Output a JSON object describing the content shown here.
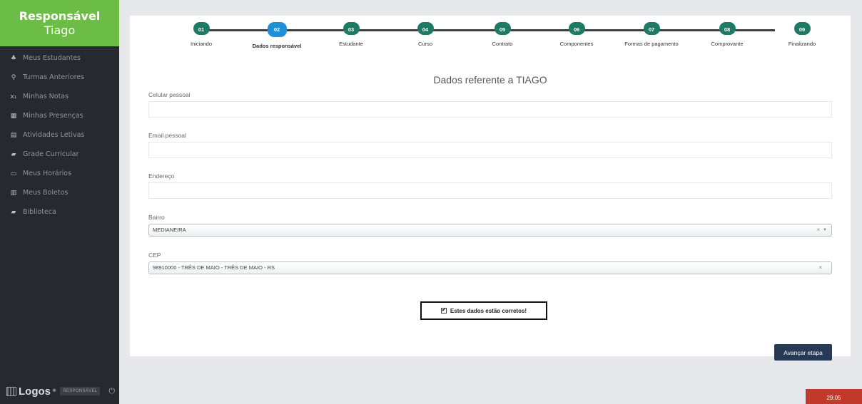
{
  "sidebar": {
    "role": "Responsável",
    "name": "Tiago",
    "items": [
      {
        "label": "Meus Estudantes",
        "icon": "♣"
      },
      {
        "label": "Turmas Anteriores",
        "icon": "⚲"
      },
      {
        "label": "Minhas Notas",
        "icon": "x₁"
      },
      {
        "label": "Minhas Presenças",
        "icon": "▦"
      },
      {
        "label": "Atividades Letivas",
        "icon": "▤"
      },
      {
        "label": "Grade Curricular",
        "icon": "▰"
      },
      {
        "label": "Meus Horários",
        "icon": "▭"
      },
      {
        "label": "Meus Boletos",
        "icon": "▥"
      },
      {
        "label": "Biblioteca",
        "icon": "▰"
      }
    ],
    "footer": {
      "logo": "Logos",
      "logo_mark": "®",
      "role_badge": "RESPONSÁVEL",
      "power_icon": "⏻"
    }
  },
  "stepper": {
    "steps": [
      {
        "num": "01",
        "label": "Iniciando"
      },
      {
        "num": "02",
        "label": "Dados responsável"
      },
      {
        "num": "03",
        "label": "Estudante"
      },
      {
        "num": "04",
        "label": "Curso"
      },
      {
        "num": "05",
        "label": "Contrato"
      },
      {
        "num": "06",
        "label": "Componentes"
      },
      {
        "num": "07",
        "label": "Formas de pagamento"
      },
      {
        "num": "08",
        "label": "Comprovante"
      },
      {
        "num": "09",
        "label": "Finalizando"
      }
    ],
    "active_step": "02"
  },
  "form": {
    "title": "Dados referente a TIAGO",
    "celular_label": "Celular pessoal",
    "celular_value": "",
    "email_label": "Email pessoal",
    "email_value": "",
    "endereco_label": "Endereço",
    "endereco_value": "",
    "bairro_label": "Bairro",
    "bairro_value": "MEDIANEIRA",
    "cep_label": "CEP",
    "cep_value": "98910000 - TRÊS DE MAIO - TRÊS DE MAIO - RS",
    "clear_glyph": "×",
    "arrow_glyph": "▼",
    "confirm_label": "Estes dados estão corretos!",
    "confirm_checked": true,
    "check_glyph": "✔",
    "advance_label": "Avançar etapa"
  },
  "timer": "29:05",
  "colors": {
    "sidebar_header": "#6cbd45",
    "step_done": "#1f7a64",
    "step_active": "#1e90d6",
    "button": "#263a55",
    "timer": "#c0392b"
  }
}
